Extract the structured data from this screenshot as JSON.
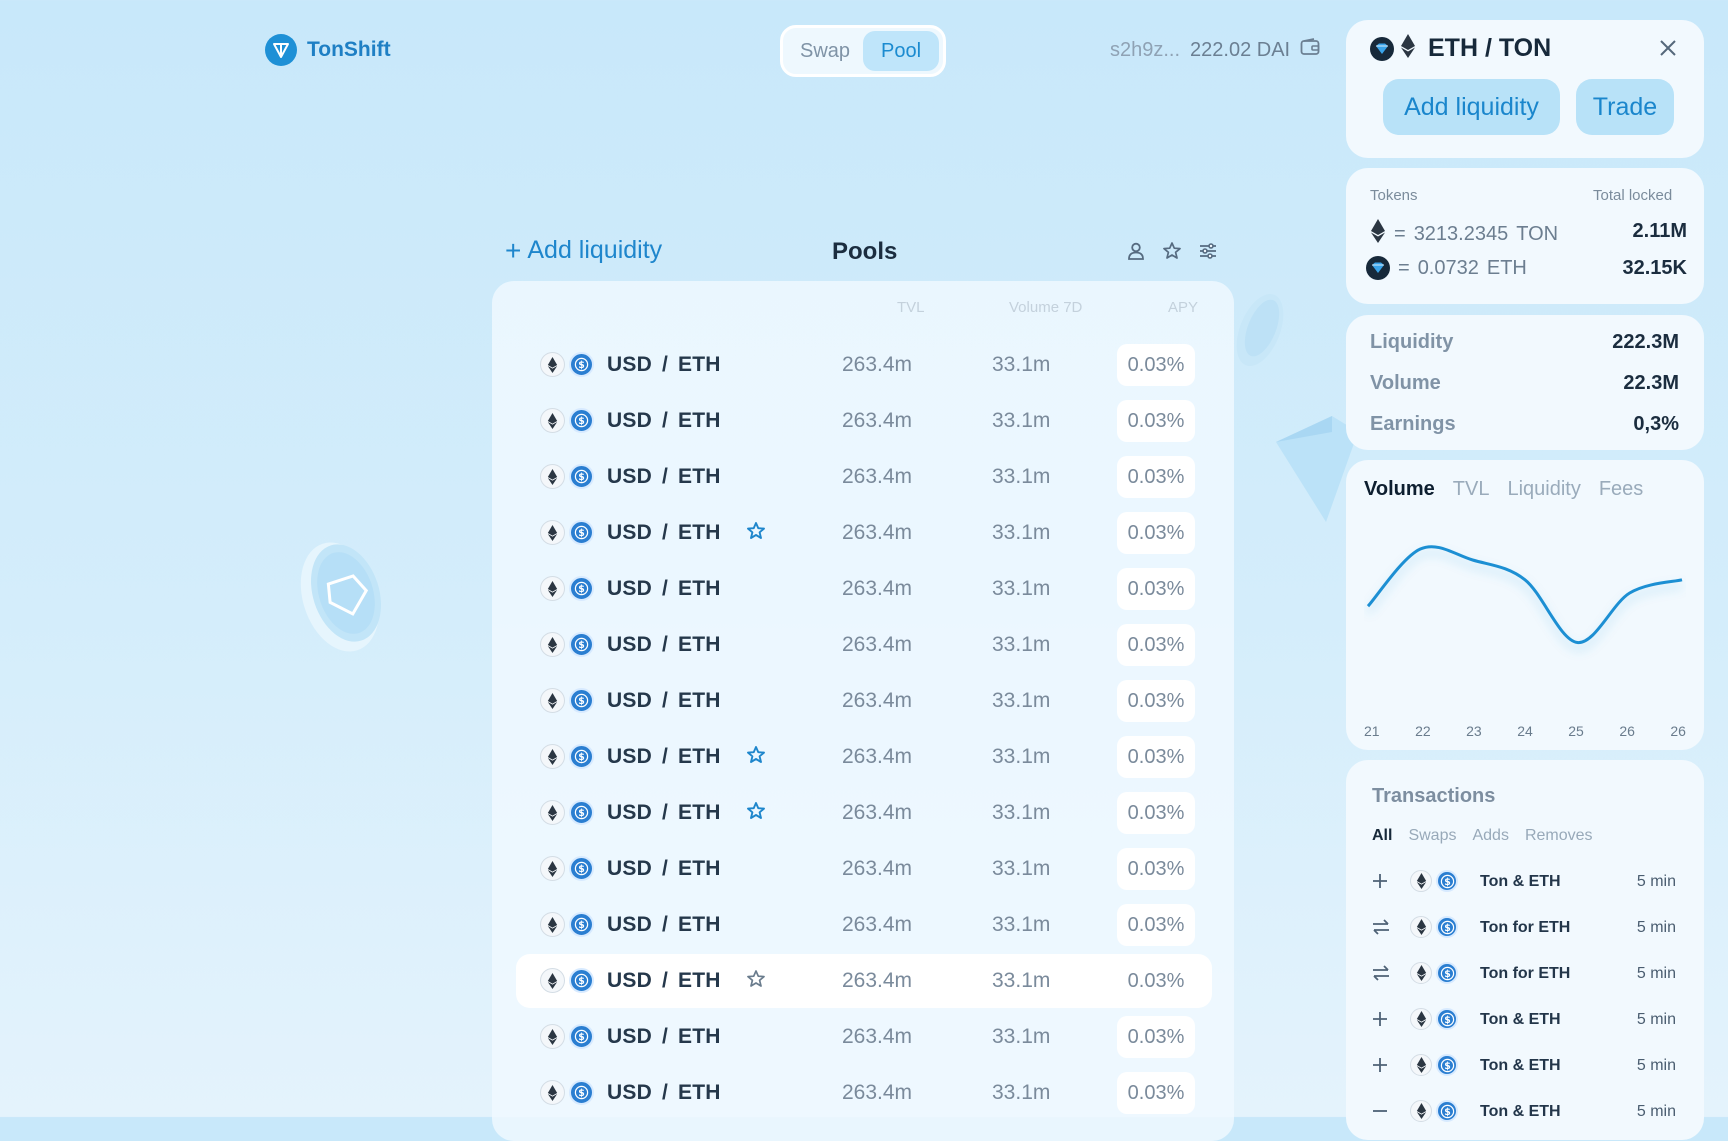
{
  "brand": {
    "name": "TonShift"
  },
  "nav": {
    "tabs": [
      "Swap",
      "Pool"
    ],
    "active": "Pool"
  },
  "wallet": {
    "address": "s2h9z...",
    "balance": "222.02 DAI"
  },
  "pools": {
    "add_liquidity": "Add liquidity",
    "title": "Pools",
    "columns": {
      "tvl": "TVL",
      "volume": "Volume 7D",
      "apy": "APY"
    },
    "rows": [
      {
        "pair_a": "USD",
        "sep": "/",
        "pair_b": "ETH",
        "tvl": "263.4m",
        "volume": "33.1m",
        "apy": "0.03%",
        "favorite": false,
        "highlight": false
      },
      {
        "pair_a": "USD",
        "sep": "/",
        "pair_b": "ETH",
        "tvl": "263.4m",
        "volume": "33.1m",
        "apy": "0.03%",
        "favorite": false,
        "highlight": false
      },
      {
        "pair_a": "USD",
        "sep": "/",
        "pair_b": "ETH",
        "tvl": "263.4m",
        "volume": "33.1m",
        "apy": "0.03%",
        "favorite": false,
        "highlight": false
      },
      {
        "pair_a": "USD",
        "sep": "/",
        "pair_b": "ETH",
        "tvl": "263.4m",
        "volume": "33.1m",
        "apy": "0.03%",
        "favorite": true,
        "highlight": false
      },
      {
        "pair_a": "USD",
        "sep": "/",
        "pair_b": "ETH",
        "tvl": "263.4m",
        "volume": "33.1m",
        "apy": "0.03%",
        "favorite": false,
        "highlight": false
      },
      {
        "pair_a": "USD",
        "sep": "/",
        "pair_b": "ETH",
        "tvl": "263.4m",
        "volume": "33.1m",
        "apy": "0.03%",
        "favorite": false,
        "highlight": false
      },
      {
        "pair_a": "USD",
        "sep": "/",
        "pair_b": "ETH",
        "tvl": "263.4m",
        "volume": "33.1m",
        "apy": "0.03%",
        "favorite": false,
        "highlight": false
      },
      {
        "pair_a": "USD",
        "sep": "/",
        "pair_b": "ETH",
        "tvl": "263.4m",
        "volume": "33.1m",
        "apy": "0.03%",
        "favorite": true,
        "highlight": false
      },
      {
        "pair_a": "USD",
        "sep": "/",
        "pair_b": "ETH",
        "tvl": "263.4m",
        "volume": "33.1m",
        "apy": "0.03%",
        "favorite": true,
        "highlight": false
      },
      {
        "pair_a": "USD",
        "sep": "/",
        "pair_b": "ETH",
        "tvl": "263.4m",
        "volume": "33.1m",
        "apy": "0.03%",
        "favorite": false,
        "highlight": false
      },
      {
        "pair_a": "USD",
        "sep": "/",
        "pair_b": "ETH",
        "tvl": "263.4m",
        "volume": "33.1m",
        "apy": "0.03%",
        "favorite": false,
        "highlight": false
      },
      {
        "pair_a": "USD",
        "sep": "/",
        "pair_b": "ETH",
        "tvl": "263.4m",
        "volume": "33.1m",
        "apy": "0.03%",
        "favorite": "outline",
        "highlight": true
      },
      {
        "pair_a": "USD",
        "sep": "/",
        "pair_b": "ETH",
        "tvl": "263.4m",
        "volume": "33.1m",
        "apy": "0.03%",
        "favorite": false,
        "highlight": false
      },
      {
        "pair_a": "USD",
        "sep": "/",
        "pair_b": "ETH",
        "tvl": "263.4m",
        "volume": "33.1m",
        "apy": "0.03%",
        "favorite": false,
        "highlight": false
      }
    ]
  },
  "detail": {
    "title": "ETH / TON",
    "add_liquidity": "Add liquidity",
    "trade": "Trade",
    "tokens_label": "Tokens",
    "total_locked_label": "Total locked",
    "token_rows": [
      {
        "icon": "eth-icon",
        "eq": "=",
        "amount": "3213.2345",
        "symbol": "TON",
        "locked": "2.11M"
      },
      {
        "icon": "ton-icon",
        "eq": "=",
        "amount": "0.0732",
        "symbol": "ETH",
        "locked": "32.15K"
      }
    ],
    "stats": [
      {
        "label": "Liquidity",
        "value": "222.3M"
      },
      {
        "label": "Volume",
        "value": "22.3M"
      },
      {
        "label": "Earnings",
        "value": "0,3%"
      }
    ],
    "chart_tabs": [
      "Volume",
      "TVL",
      "Liquidity",
      "Fees"
    ],
    "chart_active": "Volume",
    "transactions_title": "Transactions",
    "tx_tabs": [
      "All",
      "Swaps",
      "Adds",
      "Removes"
    ],
    "tx_active": "All",
    "transactions": [
      {
        "type": "add",
        "label": "Ton & ETH",
        "time": "5 min"
      },
      {
        "type": "swap",
        "label": "Ton for ETH",
        "time": "5 min"
      },
      {
        "type": "swap",
        "label": "Ton for ETH",
        "time": "5 min"
      },
      {
        "type": "add",
        "label": "Ton & ETH",
        "time": "5 min"
      },
      {
        "type": "add",
        "label": "Ton & ETH",
        "time": "5 min"
      },
      {
        "type": "remove",
        "label": "Ton & ETH",
        "time": "5 min"
      }
    ]
  },
  "chart_data": {
    "type": "line",
    "title": "",
    "xlabel": "",
    "ylabel": "",
    "x": [
      "21",
      "22",
      "23",
      "24",
      "25",
      "26",
      "26"
    ],
    "series": [
      {
        "values": [
          0.38,
          0.9,
          0.8,
          0.62,
          0.05,
          0.5,
          0.62
        ]
      }
    ],
    "ylim": [
      0,
      1
    ],
    "grid": false,
    "color": "#1e8fd3"
  },
  "colors": {
    "accent": "#1e86cc",
    "accent_light": "#b8e2f8",
    "usd_coin": "#2a7ed1"
  }
}
